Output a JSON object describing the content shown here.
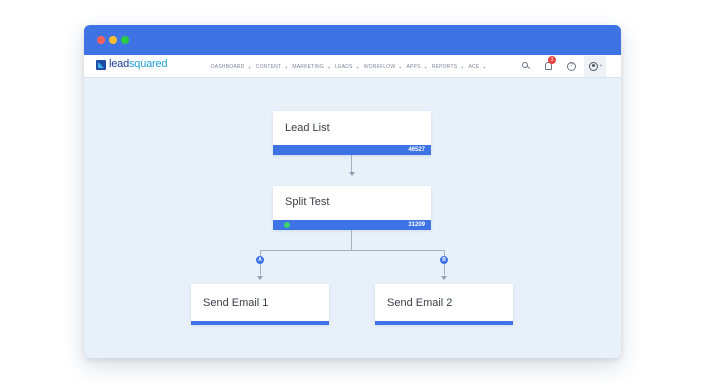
{
  "window": {
    "accent": "#3f73e3"
  },
  "navbar": {
    "logo_parts": {
      "lead": "lead",
      "squared": "squared"
    },
    "menu": [
      {
        "label": "DASHBOARD"
      },
      {
        "label": "CONTENT"
      },
      {
        "label": "MARKETING"
      },
      {
        "label": "LEADS"
      },
      {
        "label": "WORKFLOW"
      },
      {
        "label": "APPS"
      },
      {
        "label": "REPORTS"
      },
      {
        "label": "ACE"
      }
    ],
    "notification_count": "3",
    "help_glyph": "?"
  },
  "flow": {
    "lead_list": {
      "title": "Lead List",
      "count": "46527"
    },
    "split_test": {
      "title": "Split Test",
      "count": "31209"
    },
    "branches": [
      {
        "label": "A"
      },
      {
        "label": "B"
      }
    ],
    "email_1": {
      "title": "Send Email 1"
    },
    "email_2": {
      "title": "Send Email 2"
    }
  },
  "colors": {
    "canvas_bg": "#e8f1f9",
    "node_bar": "#3d73e4",
    "status_active": "#3dd46a",
    "badge": "#e6423d"
  },
  "icons": [
    "search-icon",
    "bell-icon",
    "help-icon",
    "user-icon"
  ]
}
